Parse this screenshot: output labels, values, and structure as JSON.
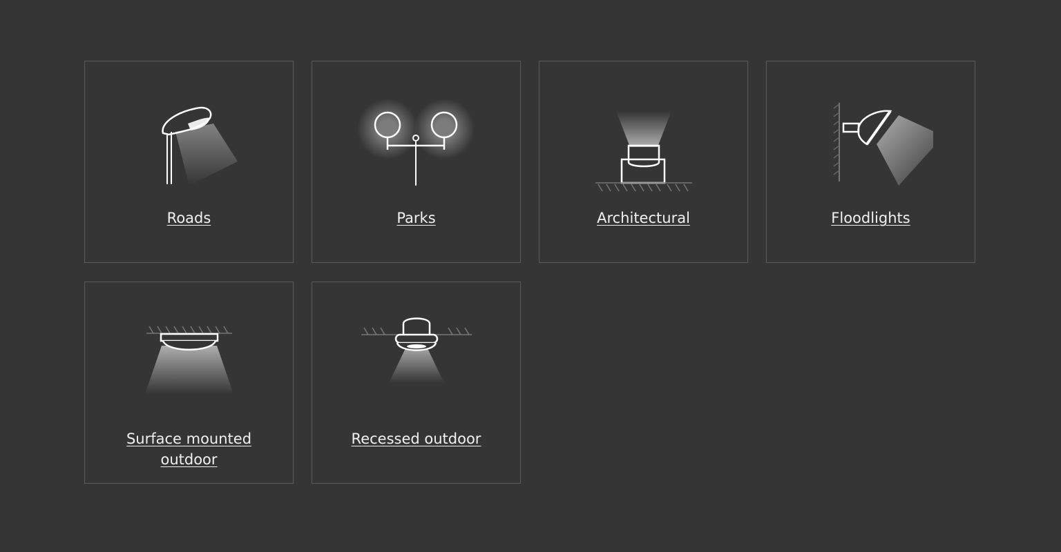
{
  "categories": [
    {
      "label": "Roads",
      "icon": "street-lamp-icon"
    },
    {
      "label": "Parks",
      "icon": "park-lamp-icon"
    },
    {
      "label": "Architectural",
      "icon": "uplight-icon"
    },
    {
      "label": "Floodlights",
      "icon": "floodlight-icon"
    },
    {
      "label": "Surface mounted outdoor",
      "icon": "surface-mounted-light-icon"
    },
    {
      "label": "Recessed outdoor",
      "icon": "recessed-light-icon"
    }
  ],
  "colors": {
    "background": "#353535",
    "border": "#5b5b5b",
    "text": "#f2f2f2",
    "icon_stroke": "#ffffff"
  }
}
